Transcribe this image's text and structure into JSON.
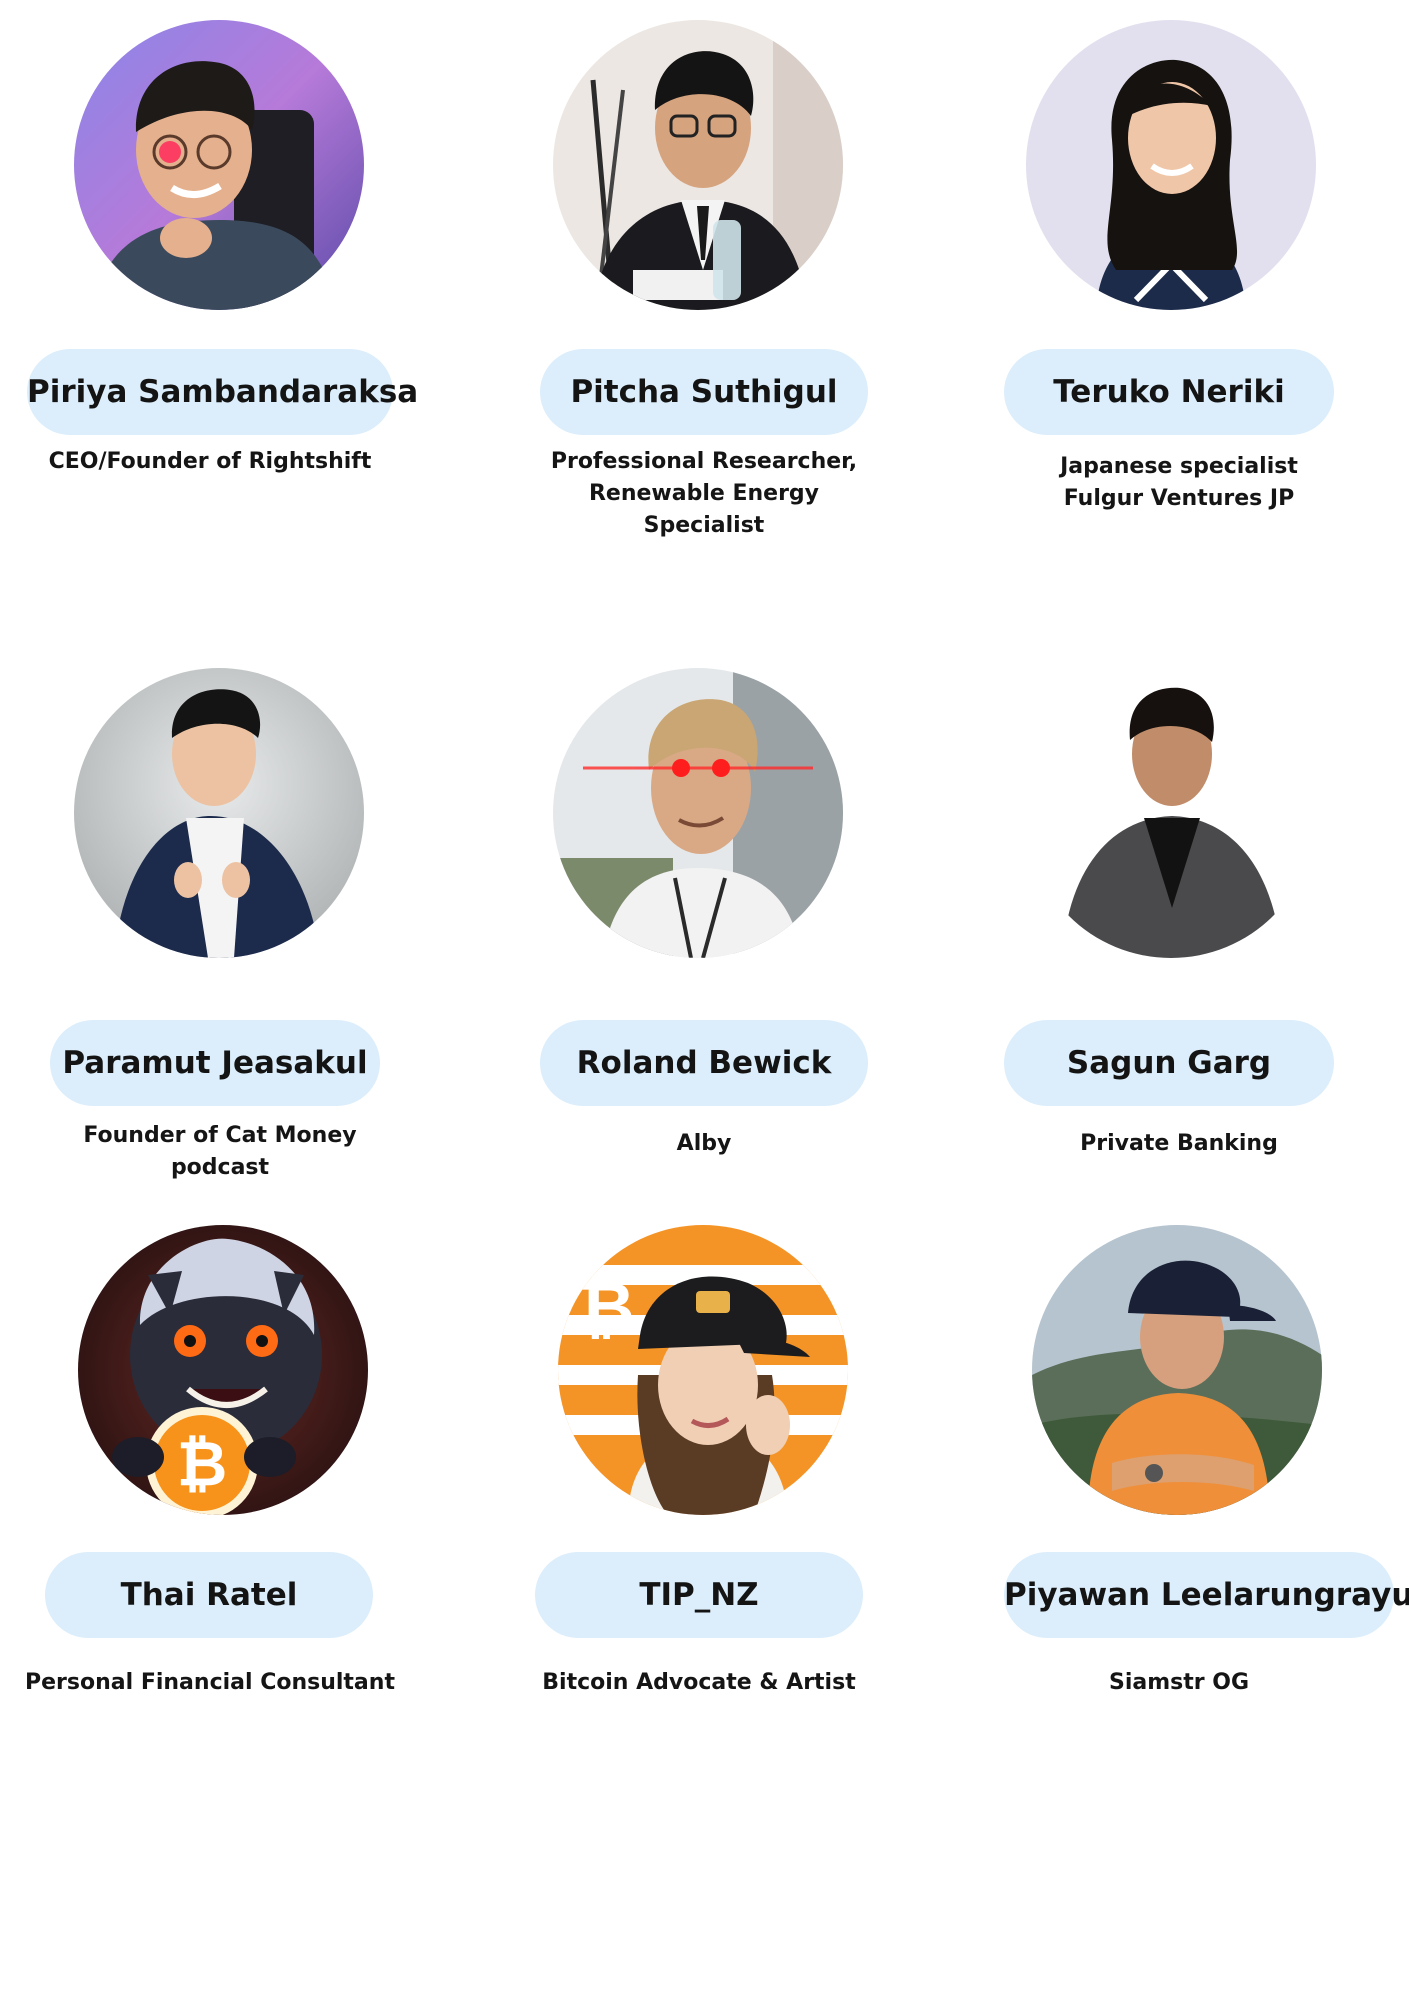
{
  "speakers": [
    {
      "name": "Piriya Sambandaraksa",
      "role_lines": [
        "CEO/Founder of Rightshift"
      ],
      "avatar": "photo-man-glasses-laser-eye"
    },
    {
      "name": "Pitcha Suthigul",
      "role_lines": [
        "Professional Researcher,",
        "Renewable Energy",
        "Specialist"
      ],
      "avatar": "photo-man-suit-microphone"
    },
    {
      "name": "Teruko Neriki",
      "role_lines": [
        "Japanese specialist",
        "Fulgur Ventures JP"
      ],
      "avatar": "photo-woman-smiling"
    },
    {
      "name": "Paramut Jeasakul",
      "role_lines": [
        "Founder of Cat Money",
        "podcast"
      ],
      "avatar": "photo-man-navy-suit"
    },
    {
      "name": "Roland Bewick",
      "role_lines": [
        "Alby"
      ],
      "avatar": "photo-man-laser-eyes"
    },
    {
      "name": "Sagun Garg",
      "role_lines": [
        "Private Banking"
      ],
      "avatar": "photo-man-grey-blazer"
    },
    {
      "name": "Thai Ratel",
      "role_lines": [
        "Personal Financial Consultant"
      ],
      "avatar": "illustration-honey-badger-bitcoin"
    },
    {
      "name": "TIP_NZ",
      "role_lines": [
        "Bitcoin Advocate & Artist"
      ],
      "avatar": "photo-woman-cap-bitcoin-flag"
    },
    {
      "name": "Piyawan Leelarungrayub",
      "role_lines": [
        "Siamstr OG"
      ],
      "avatar": "photo-person-cap-orange-shirt"
    }
  ],
  "colors": {
    "name_pill": "#dceefb",
    "text": "#151515",
    "background": "#ffffff",
    "bitcoin_orange": "#f7931a"
  }
}
